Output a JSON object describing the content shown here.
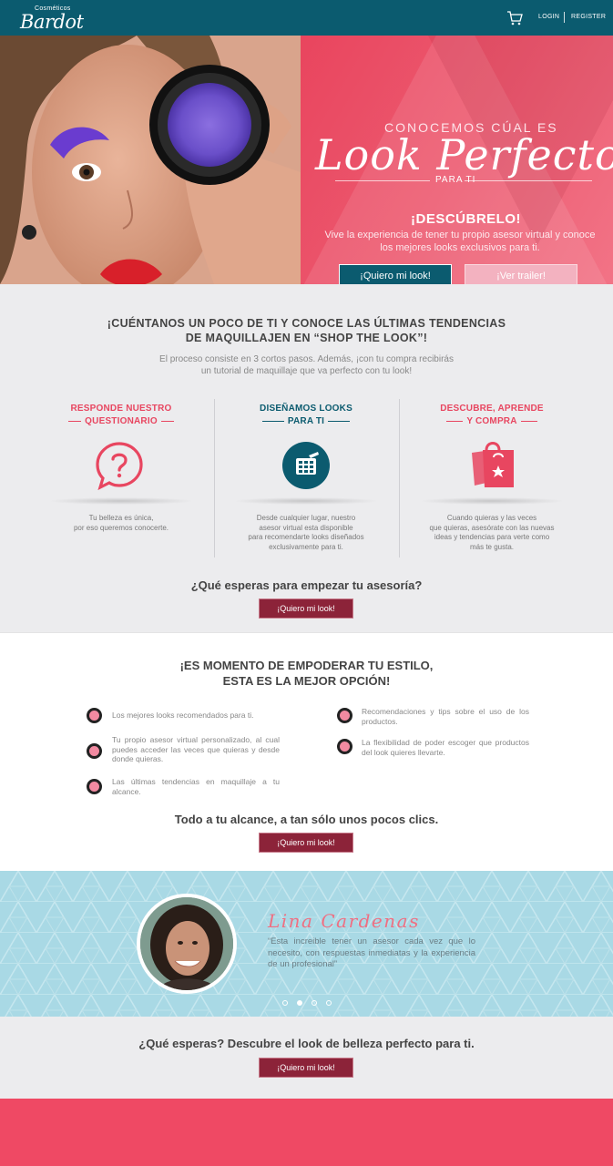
{
  "header": {
    "logo_small": "Cosméticos",
    "logo_main": "Bardot",
    "cart_icon": "cart-icon",
    "login_label": "LOGIN",
    "register_label": "REGISTER"
  },
  "hero": {
    "line1": "CONOCEMOS CÚAL ES",
    "line2": "Look Perfecto",
    "line3": "PARA TI",
    "cta_title": "¡DESCÚBRELO!",
    "description": "Vive la experiencia de tener tu propio asesor virtual y conoce los mejores looks exclusivos para ti.",
    "primary_button": "¡Quiero mi look!",
    "secondary_button": "¡Ver trailer!"
  },
  "steps_section": {
    "title_line1": "¡CUÉNTANOS UN POCO DE TI Y CONOCE LAS ÚLTIMAS TENDENCIAS",
    "title_line2": "DE MAQUILLAJEN EN “SHOP THE LOOK”!",
    "subtitle_line1": "El proceso consiste en 3 cortos pasos. Además, ¡con tu compra recibirás",
    "subtitle_line2": "un tutorial de maquillaje que va perfecto con tu look!",
    "steps": [
      {
        "title_line1": "RESPONDE NUESTRO",
        "title_line2": "QUESTIONARIO",
        "icon": "question-chat-icon",
        "text_line1": "Tu belleza es única,",
        "text_line2": "por eso queremos conocerte.",
        "text_line3": "",
        "text_line4": ""
      },
      {
        "title_line1": "DISEÑAMOS LOOKS",
        "title_line2": "PARA TI",
        "icon": "palette-icon",
        "text_line1": "Desde cualquier lugar, nuestro",
        "text_line2": "asesor virtual esta disponible",
        "text_line3": "para recomendarte looks diseñados",
        "text_line4": "exclusivamente para ti."
      },
      {
        "title_line1": "DESCUBRE, APRENDE",
        "title_line2": "Y COMPRA",
        "icon": "shopping-bag-icon",
        "text_line1": "Cuando quieras y las veces",
        "text_line2": "que quieras, asesórate con las nuevas",
        "text_line3": "ideas y tendencias para verte como",
        "text_line4": "más te gusta."
      }
    ],
    "question": "¿Qué esperas para empezar tu asesoría?",
    "button": "¡Quiero mi look!"
  },
  "benefits_section": {
    "title_line1": "¡ES MOMENTO DE EMPODERAR TU ESTILO,",
    "title_line2": "ESTA ES LA MEJOR OPCIÓN!",
    "items": [
      "Los mejores looks recomendados para ti.",
      "Tu propio asesor virtual personalizado, al cual puedes acceder las veces que quieras y desde donde quieras.",
      "Las últimas tendencias en maquillaje a tu alcance.",
      "Recomendaciones y tips sobre el uso de los productos.",
      "La flexibilidad de poder escoger que productos del look quieres llevarte."
    ],
    "question": "Todo a tu alcance, a tan sólo unos pocos clics.",
    "button": "¡Quiero mi look!"
  },
  "testimonial": {
    "name": "Lina Cardenas",
    "quote": "“Esta increible tener un asesor cada vez que lo necesito, con respuestas inmediatas y la experiencia de un profesional”",
    "slides": 4,
    "active_slide": 2
  },
  "final_cta": {
    "question": "¿Qué esperas? Descubre el look de belleza perfecto para ti.",
    "button": "¡Quiero mi look!"
  },
  "colors": {
    "primary_teal": "#0b5b6f",
    "accent_pink": "#e84660",
    "button_dark": "#8c2339",
    "footer_pink": "#ef4964"
  }
}
